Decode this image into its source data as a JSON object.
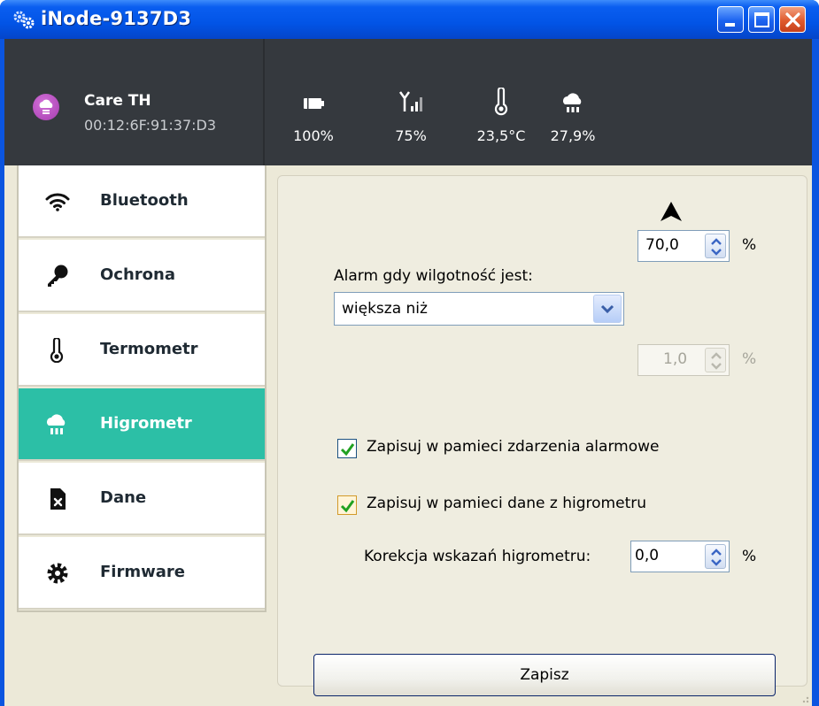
{
  "window": {
    "title": "iNode-9137D3",
    "controls": {
      "minimize": "minimize",
      "maximize": "maximize",
      "close": "close"
    }
  },
  "device": {
    "name": "Care TH",
    "mac": "00:12:6F:91:37:D3",
    "icon": "hygrometer-cloud-icon"
  },
  "stats": [
    {
      "id": "battery",
      "icon": "battery-icon",
      "value": "100%"
    },
    {
      "id": "signal",
      "icon": "signal-icon",
      "value": "75%"
    },
    {
      "id": "temperature",
      "icon": "thermometer-icon",
      "value": "23,5°C"
    },
    {
      "id": "humidity",
      "icon": "humidity-icon",
      "value": "27,9%"
    }
  ],
  "sidebar": {
    "items": [
      {
        "label": "Bluetooth",
        "icon": "wifi-icon",
        "active": false
      },
      {
        "label": "Ochrona",
        "icon": "key-icon",
        "active": false
      },
      {
        "label": "Termometr",
        "icon": "thermometer-icon",
        "active": false
      },
      {
        "label": "Higrometr",
        "icon": "humidity-icon",
        "active": true
      },
      {
        "label": "Dane",
        "icon": "file-x-icon",
        "active": false
      },
      {
        "label": "Firmware",
        "icon": "gear-icon",
        "active": false
      }
    ]
  },
  "main": {
    "threshold": {
      "value": "70,0",
      "unit": "%"
    },
    "alarm_label": "Alarm gdy wilgotność jest:",
    "alarm_condition": {
      "selected": "większa niż"
    },
    "hysteresis": {
      "value": "1,0",
      "unit": "%",
      "disabled": true
    },
    "log_alarm_events": {
      "label": "Zapisuj w pamieci zdarzenia alarmowe",
      "checked": true
    },
    "log_hygrometer_data": {
      "label": "Zapisuj w pamieci dane z higrometru",
      "checked": true
    },
    "correction": {
      "label": "Korekcja wskazań higrometru:",
      "value": "0,0",
      "unit": "%"
    },
    "save_label": "Zapisz"
  },
  "colors": {
    "titlebar": "#0254e6",
    "header": "#35393e",
    "accent": "#2cbfa6",
    "panel": "#efede0"
  }
}
